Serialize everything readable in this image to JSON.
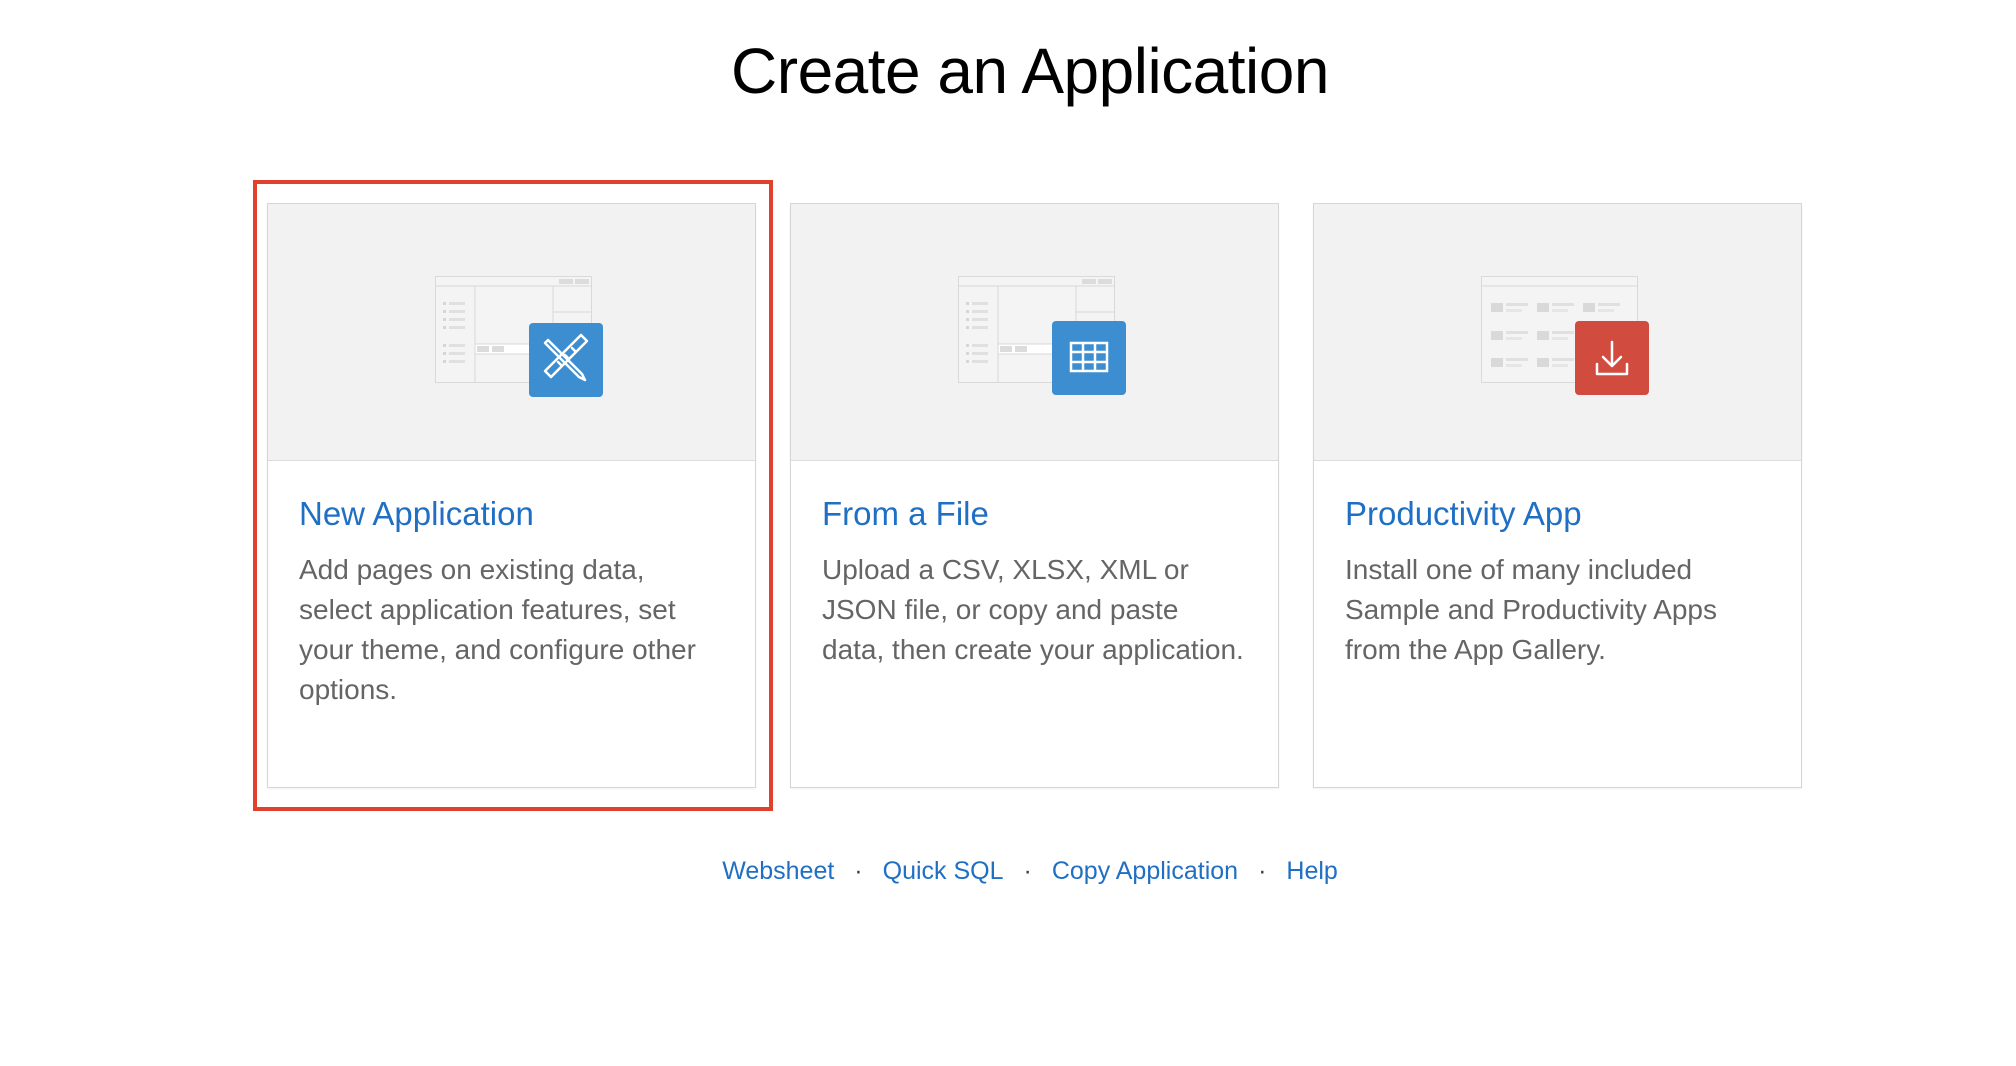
{
  "page_title": "Create an Application",
  "cards": [
    {
      "title": "New Application",
      "description": "Add pages on existing data, select application features, set your theme, and configure other options.",
      "icon": "design-tools-icon",
      "icon_color": "#3d8ed0",
      "selected": true
    },
    {
      "title": "From a File",
      "description": "Upload a CSV, XLSX, XML or JSON file, or copy and paste data, then create your application.",
      "icon": "table-grid-icon",
      "icon_color": "#3d8ed0",
      "selected": false
    },
    {
      "title": "Productivity App",
      "description": "Install one of many included Sample and Productivity Apps from the App Gallery.",
      "icon": "download-icon",
      "icon_color": "#d14b3e",
      "selected": false
    }
  ],
  "links": [
    "Websheet",
    "Quick SQL",
    "Copy Application",
    "Help"
  ],
  "link_separator": "·",
  "colors": {
    "link": "#1f6fc4",
    "highlight": "#e0412c",
    "card_header_bg": "#f2f2f2"
  }
}
